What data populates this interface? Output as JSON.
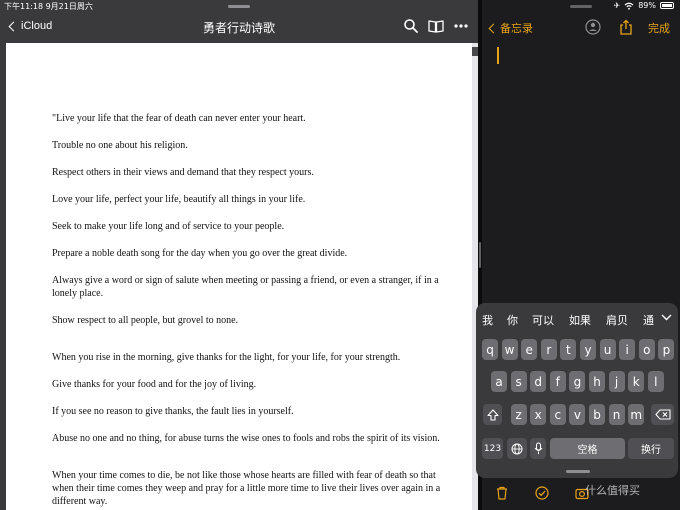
{
  "status": {
    "time_date": "下午11:18   9月21日周六",
    "battery": "89%"
  },
  "left": {
    "back_label": "iCloud",
    "title": "勇者行动诗歌",
    "icons": [
      "search-icon",
      "book-icon",
      "more-icon"
    ]
  },
  "poem": [
    "\"Live your life that the fear of death can never enter your heart.",
    "Trouble no one about his religion.",
    "Respect others in their views and demand that they respect yours.",
    "Love your life, perfect your life, beautify all things in your life.",
    "Seek to make your life long and of service to your people.",
    "Prepare a noble death song for the day when you go over the great divide.",
    "Always give a word or sign of salute when meeting or passing a friend, or even a stranger, if in a",
    "lonely place.",
    "Show respect to all people, but grovel to none.",
    "When you rise in the morning, give thanks for the light, for your life, for your strength.",
    "Give thanks for your food and for the joy of living.",
    "If you see no reason to give thanks, the fault lies in yourself.",
    "Abuse no one and no thing, for abuse turns the wise ones to fools and robs the spirit of its vision.",
    "When your time comes to die, be not like those whose hearts are filled with fear of death so that",
    "when their time comes they weep and pray for a little more time to live their lives over again in a",
    "different way."
  ],
  "notes": {
    "back_label": "备忘录",
    "done_label": "完成",
    "accent_color": "#e8a317"
  },
  "keyboard": {
    "candidates": [
      "我",
      "你",
      "可以",
      "如果",
      "肩贝",
      "通"
    ],
    "row1": [
      "q",
      "w",
      "e",
      "r",
      "t",
      "y",
      "u",
      "i",
      "o",
      "p"
    ],
    "row2": [
      "a",
      "s",
      "d",
      "f",
      "g",
      "h",
      "j",
      "k",
      "l"
    ],
    "row3": [
      "z",
      "x",
      "c",
      "v",
      "b",
      "n",
      "m"
    ],
    "numbers_key": "123",
    "space_key": "空格",
    "return_key": "换行"
  },
  "watermark": "什么值得买"
}
